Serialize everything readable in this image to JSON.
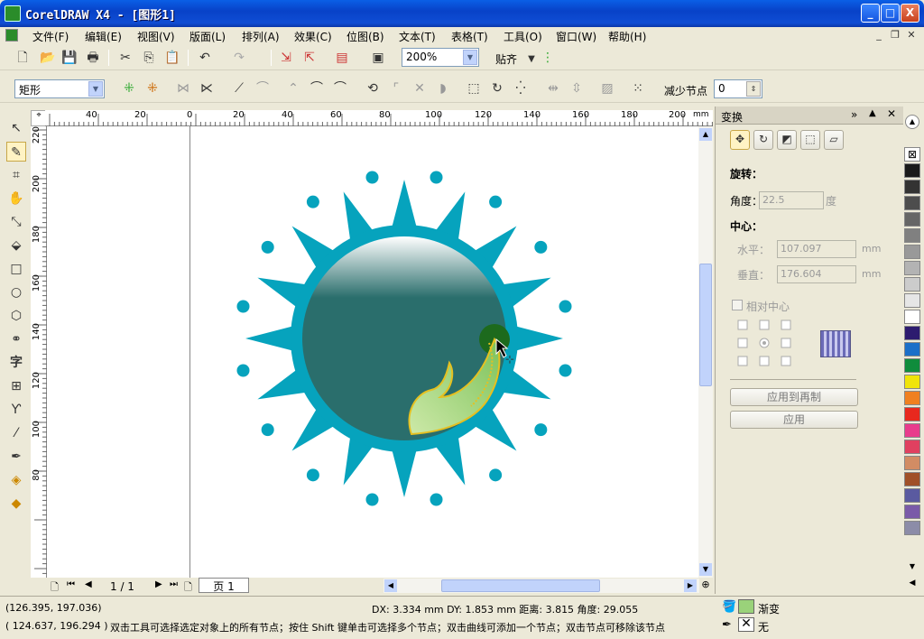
{
  "window": {
    "title": "CorelDRAW X4 - [图形1]",
    "min": "_",
    "max": "□",
    "close": "X"
  },
  "menu": [
    "文件(F)",
    "编辑(E)",
    "视图(V)",
    "版面(L)",
    "排列(A)",
    "效果(C)",
    "位图(B)",
    "文本(T)",
    "表格(T)",
    "工具(O)",
    "窗口(W)",
    "帮助(H)"
  ],
  "toolbar": {
    "zoom": "200%",
    "snap": "贴齐"
  },
  "propbar": {
    "shape_select": "矩形",
    "reduce_nodes_label": "减少节点",
    "reduce_nodes_value": "0"
  },
  "ruler_h": [
    "40",
    "20",
    "0",
    "20",
    "40",
    "60",
    "80",
    "100",
    "120",
    "140",
    "160",
    "180",
    "200",
    "mm"
  ],
  "ruler_v": [
    "220",
    "200",
    "180",
    "160",
    "140",
    "120",
    "100",
    "80"
  ],
  "pages": {
    "count": "1 / 1",
    "tab": "页 1"
  },
  "docker": {
    "title": "变换",
    "rotate_label": "旋转：",
    "angle_label": "角度：",
    "angle_value": "22.5",
    "angle_unit": "度",
    "center_label": "中心：",
    "h_label": "水平：",
    "h_value": "107.097",
    "h_unit": "mm",
    "v_label": "垂直：",
    "v_value": "176.604",
    "v_unit": "mm",
    "relative_center": "相对中心",
    "apply_copy": "应用到再制",
    "apply": "应用"
  },
  "status": {
    "cursor": "(126.395, 197.036)",
    "node": "( 124.637, 196.294 )",
    "measure": "DX: 3.334 mm DY: 1.853 mm 距离: 3.815 角度: 29.055",
    "hint": "双击工具可选择选定对象上的所有节点；按住 Shift 键单击可选择多个节点；双击曲线可添加一个节点；双击节点可移除该节点",
    "fill_label": "渐变",
    "outline_label": "无"
  },
  "palette": [
    "#1a1a1a",
    "#333333",
    "#4d4d4d",
    "#666666",
    "#808080",
    "#999999",
    "#b3b3b3",
    "#cccccc",
    "#e6e6e6",
    "#ffffff",
    "#2d1b6f",
    "#1b6fc8",
    "#0f8c3c",
    "#f0e40a",
    "#f08020",
    "#e8281e",
    "#e83c8c",
    "#e04060",
    "#d28c64",
    "#a05028",
    "#5a5aa0",
    "#7a5aa8",
    "#8c8ca8"
  ],
  "colors": {
    "teal": "#06a3bd",
    "dark_teal": "#2a6e6c",
    "leaf": "#9ad27a"
  }
}
